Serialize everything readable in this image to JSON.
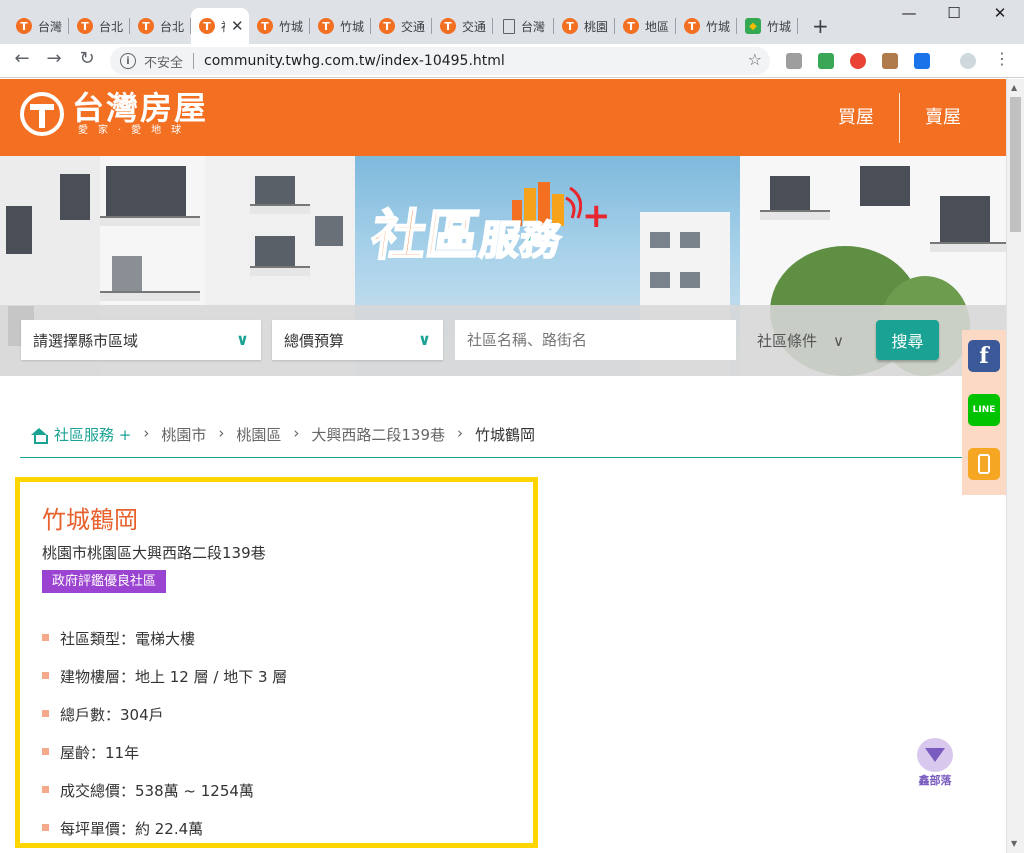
{
  "browser": {
    "tabs": [
      {
        "icon": "twhg",
        "title": "台灣"
      },
      {
        "icon": "twhg",
        "title": "台北"
      },
      {
        "icon": "twhg",
        "title": "台北"
      },
      {
        "icon": "twhg",
        "title": "社",
        "active": true
      },
      {
        "icon": "twhg",
        "title": "竹城"
      },
      {
        "icon": "twhg",
        "title": "竹城"
      },
      {
        "icon": "twhg",
        "title": "交通"
      },
      {
        "icon": "twhg",
        "title": "交通"
      },
      {
        "icon": "doc",
        "title": "台灣"
      },
      {
        "icon": "twhg",
        "title": "桃園"
      },
      {
        "icon": "twhg",
        "title": "地區"
      },
      {
        "icon": "twhg",
        "title": "竹城"
      },
      {
        "icon": "map",
        "title": "竹城"
      }
    ],
    "security_label": "不安全",
    "url": "community.twhg.com.tw/index-10495.html"
  },
  "header": {
    "logo_text": "台灣房屋",
    "logo_tagline": "愛家·愛地球",
    "nav": [
      "買屋",
      "賣屋"
    ]
  },
  "banner": {
    "slogan_part1": "社區",
    "slogan_part2": "服務",
    "slogan_plus": "+"
  },
  "search": {
    "region_label": "請選擇縣市區域",
    "budget_label": "總價預算",
    "keyword_placeholder": "社區名稱、路街名",
    "conditions_label": "社區條件",
    "button_label": "搜尋"
  },
  "breadcrumb": {
    "items": [
      "社區服務 +",
      "桃園市",
      "桃園區",
      "大興西路二段139巷",
      "竹城鶴岡"
    ]
  },
  "community": {
    "name": "竹城鶴岡",
    "address": "桃園市桃園區大興西路二段139巷",
    "badge": "政府評鑑優良社區",
    "attributes": [
      "社區類型：電梯大樓",
      "建物樓層：地上 12 層 / 地下 3 層",
      "總戶數：304戶",
      "屋齡：11年",
      "成交總價：538萬 ~ 1254萬",
      "每坪單價：約 22.4萬"
    ]
  },
  "social": {
    "facebook": "f",
    "line": "LINE"
  },
  "watermark": {
    "label": "鑫部落"
  },
  "colors": {
    "brand_orange": "#f36f21",
    "accent_teal": "#1aa394",
    "highlight_yellow": "#ffd500",
    "badge_purple": "#9b44d1"
  }
}
